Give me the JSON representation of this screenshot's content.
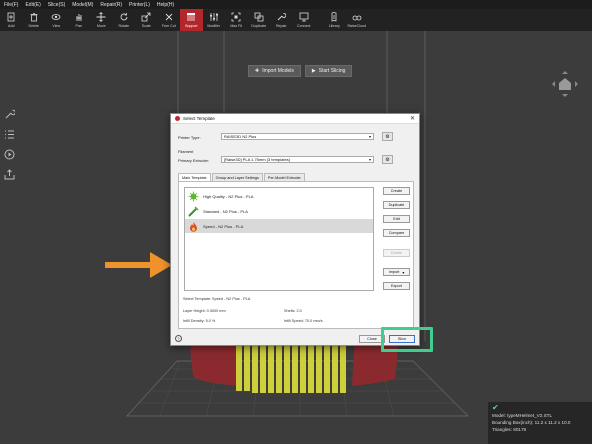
{
  "menu": [
    "File(F)",
    "Edit(E)",
    "Slice(S)",
    "Model(M)",
    "Repair(R)",
    "Printer(L)",
    "Help(H)"
  ],
  "toolbar": [
    {
      "label": "Add",
      "icon": "add-file-icon"
    },
    {
      "label": "Delete",
      "icon": "trash-icon"
    },
    {
      "label": "View",
      "icon": "eye-icon"
    },
    {
      "label": "Pan",
      "icon": "hand-icon"
    },
    {
      "label": "Move",
      "icon": "move-icon"
    },
    {
      "label": "Rotate",
      "icon": "rotate-icon"
    },
    {
      "label": "Scale",
      "icon": "scale-icon"
    },
    {
      "label": "Free Cut",
      "icon": "cut-icon"
    },
    {
      "label": "Support",
      "icon": "support-icon"
    },
    {
      "label": "Modifier",
      "icon": "modifier-icon"
    },
    {
      "label": "Max Fit",
      "icon": "max-fit-icon"
    },
    {
      "label": "Duplicate",
      "icon": "duplicate-icon"
    },
    {
      "label": "Repair",
      "icon": "wrench-icon"
    },
    {
      "label": "Connect",
      "icon": "connect-icon"
    },
    {
      "label": "Library",
      "icon": "library-icon"
    },
    {
      "label": "RaiseCloud",
      "icon": "cloud-icon"
    }
  ],
  "toolbar_active": "Support",
  "viewport": {
    "import_label": "Import Models",
    "slicing_label": "Start Slicing"
  },
  "dialog": {
    "title": "Select Template",
    "printer_type_label": "Printer Type:",
    "printer_type_value": "RAISE3D N2 Plus",
    "filament_label": "Filament",
    "primary_extruder_label": "Primary Extruder:",
    "primary_extruder_value": "[Raise3D] PLA 1.75mm (3 templates)",
    "tabs": [
      "Main Template",
      "Group and Layer Settings",
      "Per-Model Extruder"
    ],
    "templates": [
      {
        "label": "High Quality - N2 Plus - PLA",
        "icon": "high-quality-icon"
      },
      {
        "label": "Standard - N2 Plus - PLA",
        "icon": "standard-icon"
      },
      {
        "label": "Speed - N2 Plus - PLA",
        "icon": "speed-flame-icon"
      }
    ],
    "selected_index": 2,
    "side_buttons": [
      "Create",
      "Duplicate",
      "Edit",
      "Compare",
      "Delete",
      "Import",
      "Export"
    ],
    "selected_template_text": "Select Template: Speed - N2 Plus - PLA",
    "layer_height": "Layer Height: 0.3000 mm",
    "shells": "Shells: 2.0",
    "infill_density": "Infill Density: 5.0 %",
    "infill_speed": "Infill Speed: 70.0 mm/s",
    "help_label": "?",
    "close_label": "Close",
    "slice_label": "Slice"
  },
  "status": {
    "model": "Model: typeMHelmet_V2.STL",
    "bounding_box": "Bounding Box(inch): 11.2 x 11.2 x 10.0",
    "triangles": "Triangles: 80178"
  },
  "colors": {
    "accent_active": "#b3262b",
    "highlight": "#3ecf8e",
    "arrow": "#f0922c"
  }
}
